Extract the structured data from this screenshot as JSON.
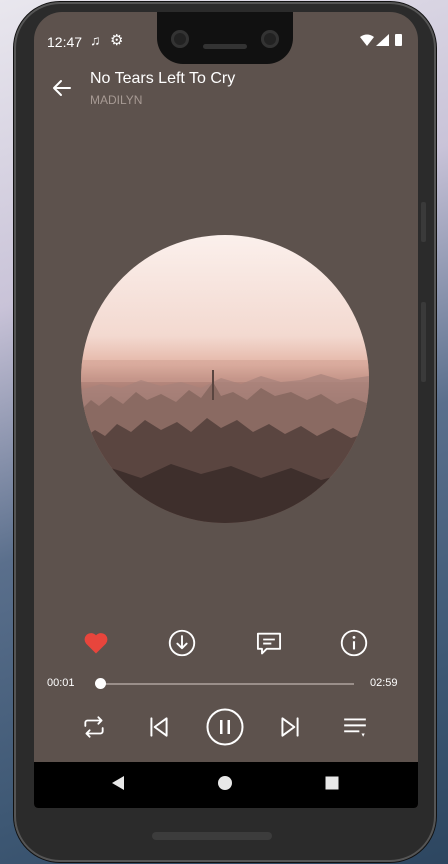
{
  "status_bar": {
    "time": "12:47",
    "icons": [
      "music-note-icon",
      "gear-icon",
      "wifi-icon",
      "signal-icon",
      "battery-icon"
    ]
  },
  "header": {
    "title": "No Tears Left To Cry",
    "artist": "MADILYN"
  },
  "actions": [
    "heart-icon",
    "download-icon",
    "comment-icon",
    "info-icon"
  ],
  "player": {
    "current_time": "00:01",
    "total_time": "02:59",
    "progress_fraction": 0.006,
    "state": "playing"
  },
  "controls": [
    "repeat-icon",
    "previous-icon",
    "pause-icon",
    "next-icon",
    "queue-icon"
  ],
  "colors": {
    "background": "#5d524d",
    "liked": "#e8453c",
    "foreground": "#ffffff",
    "artist": "#a79a94"
  },
  "navigation_bar": [
    "back-triangle-icon",
    "home-circle-icon",
    "recents-square-icon"
  ]
}
